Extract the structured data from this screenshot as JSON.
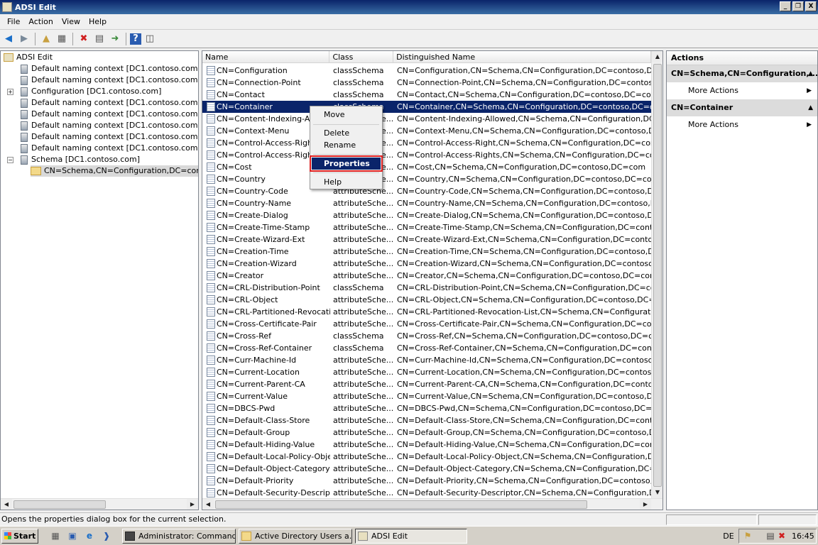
{
  "window": {
    "title": "ADSI Edit",
    "controls": [
      "_",
      "❐",
      "X"
    ]
  },
  "menu": [
    "File",
    "Action",
    "View",
    "Help"
  ],
  "toolbar_icons": [
    "back-icon",
    "forward-icon",
    "up-folder-icon",
    "show-hide-tree-icon",
    "delete-icon",
    "properties-icon",
    "export-icon",
    "help-icon",
    "show-hide-action-pane-icon"
  ],
  "tree": {
    "root": "ADSI Edit",
    "items": [
      "Default naming context [DC1.contoso.com]",
      "Default naming context [DC1.contoso.com]",
      "Configuration [DC1.contoso.com]",
      "Default naming context [DC1.contoso.com]",
      "Default naming context [DC1.contoso.com]",
      "Default naming context [DC1.contoso.com]",
      "Default naming context [DC1.contoso.com]",
      "Default naming context [DC1.contoso.com]",
      "Schema [DC1.contoso.com]",
      "CN=Schema,CN=Configuration,DC=contoso"
    ],
    "expander_plus": "+",
    "expander_minus": "−"
  },
  "list": {
    "columns": [
      "Name",
      "Class",
      "Distinguished Name"
    ],
    "rows": [
      [
        "CN=Configuration",
        "classSchema",
        "CN=Configuration,CN=Schema,CN=Configuration,DC=contoso,DC=com"
      ],
      [
        "CN=Connection-Point",
        "classSchema",
        "CN=Connection-Point,CN=Schema,CN=Configuration,DC=contoso"
      ],
      [
        "CN=Contact",
        "classSchema",
        "CN=Contact,CN=Schema,CN=Configuration,DC=contoso,DC=com"
      ],
      [
        "CN=Container",
        "classSchema",
        "CN=Container,CN=Schema,CN=Configuration,DC=contoso,DC=com"
      ],
      [
        "CN=Content-Indexing-Allowed",
        "attributeSche...",
        "CN=Content-Indexing-Allowed,CN=Schema,CN=Configuration,DC=contos"
      ],
      [
        "CN=Context-Menu",
        "attributeSche...",
        "CN=Context-Menu,CN=Schema,CN=Configuration,DC=contoso,DC=com"
      ],
      [
        "CN=Control-Access-Right",
        "attributeSche...",
        "CN=Control-Access-Right,CN=Schema,CN=Configuration,DC=contoso,DC"
      ],
      [
        "CN=Control-Access-Rights",
        "attributeSche...",
        "CN=Control-Access-Rights,CN=Schema,CN=Configuration,DC=contoso,DC"
      ],
      [
        "CN=Cost",
        "attributeSche...",
        "CN=Cost,CN=Schema,CN=Configuration,DC=contoso,DC=com"
      ],
      [
        "CN=Country",
        "attributeSche...",
        "CN=Country,CN=Schema,CN=Configuration,DC=contoso,DC=com"
      ],
      [
        "CN=Country-Code",
        "attributeSche...",
        "CN=Country-Code,CN=Schema,CN=Configuration,DC=contoso,DC=com"
      ],
      [
        "CN=Country-Name",
        "attributeSche...",
        "CN=Country-Name,CN=Schema,CN=Configuration,DC=contoso,DC=com"
      ],
      [
        "CN=Create-Dialog",
        "attributeSche...",
        "CN=Create-Dialog,CN=Schema,CN=Configuration,DC=contoso,DC=com"
      ],
      [
        "CN=Create-Time-Stamp",
        "attributeSche...",
        "CN=Create-Time-Stamp,CN=Schema,CN=Configuration,DC=contoso,DC=c"
      ],
      [
        "CN=Create-Wizard-Ext",
        "attributeSche...",
        "CN=Create-Wizard-Ext,CN=Schema,CN=Configuration,DC=contoso,DC=c"
      ],
      [
        "CN=Creation-Time",
        "attributeSche...",
        "CN=Creation-Time,CN=Schema,CN=Configuration,DC=contoso,DC=com"
      ],
      [
        "CN=Creation-Wizard",
        "attributeSche...",
        "CN=Creation-Wizard,CN=Schema,CN=Configuration,DC=contoso,DC=cor"
      ],
      [
        "CN=Creator",
        "attributeSche...",
        "CN=Creator,CN=Schema,CN=Configuration,DC=contoso,DC=com"
      ],
      [
        "CN=CRL-Distribution-Point",
        "classSchema",
        "CN=CRL-Distribution-Point,CN=Schema,CN=Configuration,DC=contoso,D"
      ],
      [
        "CN=CRL-Object",
        "attributeSche...",
        "CN=CRL-Object,CN=Schema,CN=Configuration,DC=contoso,DC=com"
      ],
      [
        "CN=CRL-Partitioned-Revocati...",
        "attributeSche...",
        "CN=CRL-Partitioned-Revocation-List,CN=Schema,CN=Configuration,DC="
      ],
      [
        "CN=Cross-Certificate-Pair",
        "attributeSche...",
        "CN=Cross-Certificate-Pair,CN=Schema,CN=Configuration,DC=contoso,DC"
      ],
      [
        "CN=Cross-Ref",
        "classSchema",
        "CN=Cross-Ref,CN=Schema,CN=Configuration,DC=contoso,DC=com"
      ],
      [
        "CN=Cross-Ref-Container",
        "classSchema",
        "CN=Cross-Ref-Container,CN=Schema,CN=Configuration,DC=contoso,DC"
      ],
      [
        "CN=Curr-Machine-Id",
        "attributeSche...",
        "CN=Curr-Machine-Id,CN=Schema,CN=Configuration,DC=contoso,DC=cor"
      ],
      [
        "CN=Current-Location",
        "attributeSche...",
        "CN=Current-Location,CN=Schema,CN=Configuration,DC=contoso,DC=co"
      ],
      [
        "CN=Current-Parent-CA",
        "attributeSche...",
        "CN=Current-Parent-CA,CN=Schema,CN=Configuration,DC=contoso,DC=c"
      ],
      [
        "CN=Current-Value",
        "attributeSche...",
        "CN=Current-Value,CN=Schema,CN=Configuration,DC=contoso,DC=com"
      ],
      [
        "CN=DBCS-Pwd",
        "attributeSche...",
        "CN=DBCS-Pwd,CN=Schema,CN=Configuration,DC=contoso,DC=com"
      ],
      [
        "CN=Default-Class-Store",
        "attributeSche...",
        "CN=Default-Class-Store,CN=Schema,CN=Configuration,DC=contoso,DC=c"
      ],
      [
        "CN=Default-Group",
        "attributeSche...",
        "CN=Default-Group,CN=Schema,CN=Configuration,DC=contoso,DC=com"
      ],
      [
        "CN=Default-Hiding-Value",
        "attributeSche...",
        "CN=Default-Hiding-Value,CN=Schema,CN=Configuration,DC=contoso,DC"
      ],
      [
        "CN=Default-Local-Policy-Object",
        "attributeSche...",
        "CN=Default-Local-Policy-Object,CN=Schema,CN=Configuration,DC=conto"
      ],
      [
        "CN=Default-Object-Category",
        "attributeSche...",
        "CN=Default-Object-Category,CN=Schema,CN=Configuration,DC=contoso"
      ],
      [
        "CN=Default-Priority",
        "attributeSche...",
        "CN=Default-Priority,CN=Schema,CN=Configuration,DC=contoso,DC=com"
      ],
      [
        "CN=Default-Security-Descriptor",
        "attributeSche...",
        "CN=Default-Security-Descriptor,CN=Schema,CN=Configuration,DC=conto"
      ]
    ],
    "selected_index": 3
  },
  "context_menu": {
    "items": [
      "Move",
      "Delete",
      "Rename",
      "Properties",
      "Help"
    ],
    "highlighted": "Properties"
  },
  "actions": {
    "header": "Actions",
    "sections": [
      {
        "title": "CN=Schema,CN=Configuration,...",
        "item": "More Actions"
      },
      {
        "title": "CN=Container",
        "item": "More Actions"
      }
    ]
  },
  "status": "Opens the properties dialog box for the current selection.",
  "taskbar": {
    "start": "Start",
    "tasks": [
      "Administrator: Command...",
      "Active Directory Users a...",
      "ADSI Edit"
    ],
    "lang": "DE",
    "clock": "16:45"
  }
}
